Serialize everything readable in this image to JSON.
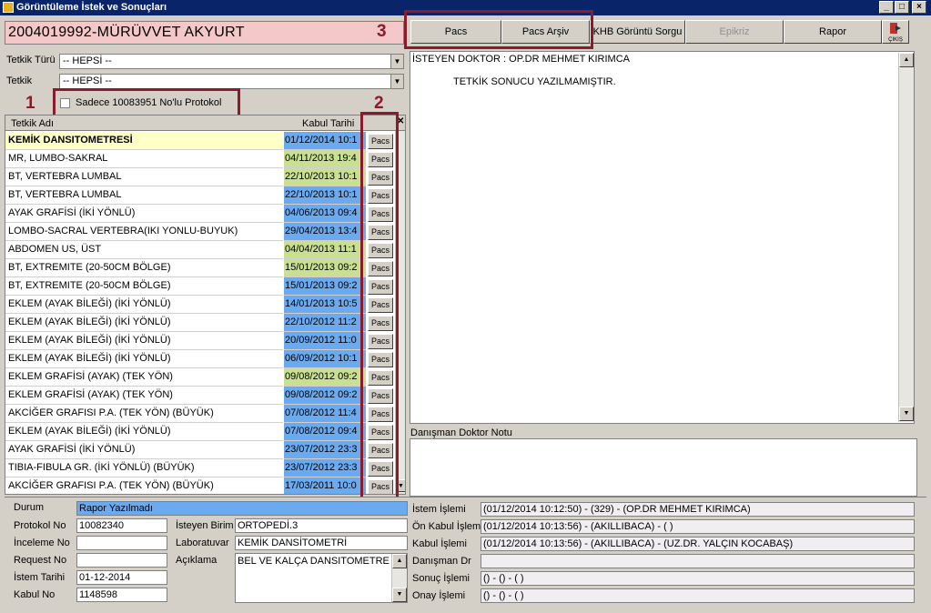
{
  "window": {
    "title": "Görüntüleme İstek ve Sonuçları"
  },
  "patient": {
    "header": "2004019992-MÜRÜVVET AKYURT"
  },
  "annotations": {
    "n1": "1",
    "n2": "2",
    "n3": "3"
  },
  "toolbar": {
    "pacs": "Pacs",
    "pacs_arsiv": "Pacs Arşiv",
    "khb": "KHB Görüntü Sorgu",
    "epikriz": "Epikriz",
    "rapor": "Rapor",
    "cikis": "ÇIKIŞ"
  },
  "filters": {
    "tetkik_turu_label": "Tetkik Türü",
    "tetkik_turu_value": "-- HEPSİ --",
    "tetkik_label": "Tetkik",
    "tetkik_value": "-- HEPSİ --",
    "protocol_checkbox_label": "Sadece 10083951 No'lu Protokol"
  },
  "grid": {
    "col_name": "Tetkik Adı",
    "col_date": "Kabul Tarihi",
    "pacs_label": "Pacs",
    "rows": [
      {
        "name": "KEMİK DANSITOMETRESİ",
        "date": "01/12/2014 10:1",
        "bold": true,
        "namecolor": "#ffffc8",
        "datecolor": "#6aaaf0"
      },
      {
        "name": "MR, LUMBO-SAKRAL",
        "date": "04/11/2013 19:4",
        "namecolor": "#ffffff",
        "datecolor": "#c8e090"
      },
      {
        "name": "BT, VERTEBRA LUMBAL",
        "date": "22/10/2013 10:1",
        "namecolor": "#ffffff",
        "datecolor": "#c8e090"
      },
      {
        "name": "BT, VERTEBRA LUMBAL",
        "date": "22/10/2013 10:1",
        "namecolor": "#ffffff",
        "datecolor": "#6aaaf0"
      },
      {
        "name": "AYAK GRAFİSİ (İKİ YÖNLÜ)",
        "date": "04/06/2013 09:4",
        "namecolor": "#ffffff",
        "datecolor": "#6aaaf0"
      },
      {
        "name": "LOMBO-SACRAL VERTEBRA(IKI YONLU-BUYUK)",
        "date": "29/04/2013 13:4",
        "namecolor": "#ffffff",
        "datecolor": "#6aaaf0"
      },
      {
        "name": "ABDOMEN US, ÜST",
        "date": "04/04/2013 11:1",
        "namecolor": "#ffffff",
        "datecolor": "#c8e090"
      },
      {
        "name": "BT, EXTREMITE (20-50CM BÖLGE)",
        "date": "15/01/2013 09:2",
        "namecolor": "#ffffff",
        "datecolor": "#c8e090"
      },
      {
        "name": "BT, EXTREMITE (20-50CM BÖLGE)",
        "date": "15/01/2013 09:2",
        "namecolor": "#ffffff",
        "datecolor": "#6aaaf0"
      },
      {
        "name": "EKLEM (AYAK BİLEĞİ) (İKİ YÖNLÜ)",
        "date": "14/01/2013 10:5",
        "namecolor": "#ffffff",
        "datecolor": "#6aaaf0"
      },
      {
        "name": "EKLEM (AYAK BİLEĞİ) (İKİ YÖNLÜ)",
        "date": "22/10/2012 11:2",
        "namecolor": "#ffffff",
        "datecolor": "#6aaaf0"
      },
      {
        "name": "EKLEM (AYAK BİLEĞİ) (İKİ YÖNLÜ)",
        "date": "20/09/2012 11:0",
        "namecolor": "#ffffff",
        "datecolor": "#6aaaf0"
      },
      {
        "name": "EKLEM (AYAK BİLEĞİ) (İKİ YÖNLÜ)",
        "date": "06/09/2012 10:1",
        "namecolor": "#ffffff",
        "datecolor": "#6aaaf0"
      },
      {
        "name": "EKLEM GRAFİSİ (AYAK) (TEK YÖN)",
        "date": "09/08/2012 09:2",
        "namecolor": "#ffffff",
        "datecolor": "#c8e090"
      },
      {
        "name": "EKLEM GRAFİSİ (AYAK) (TEK YÖN)",
        "date": "09/08/2012 09:2",
        "namecolor": "#ffffff",
        "datecolor": "#6aaaf0"
      },
      {
        "name": "AKCİĞER GRAFISI P.A. (TEK YÖN) (BÜYÜK)",
        "date": "07/08/2012 11:4",
        "namecolor": "#ffffff",
        "datecolor": "#6aaaf0"
      },
      {
        "name": "EKLEM (AYAK BİLEĞİ) (İKİ YÖNLÜ)",
        "date": "07/08/2012 09:4",
        "namecolor": "#ffffff",
        "datecolor": "#6aaaf0"
      },
      {
        "name": "AYAK GRAFİSİ (İKİ YÖNLÜ)",
        "date": "23/07/2012 23:3",
        "namecolor": "#ffffff",
        "datecolor": "#6aaaf0"
      },
      {
        "name": "TIBIA-FIBULA GR. (İKİ YÖNLÜ) (BÜYÜK)",
        "date": "23/07/2012 23:3",
        "namecolor": "#ffffff",
        "datecolor": "#6aaaf0"
      },
      {
        "name": "AKCİĞER GRAFISI P.A. (TEK YÖN) (BÜYÜK)",
        "date": "17/03/2011 10:0",
        "namecolor": "#ffffff",
        "datecolor": "#6aaaf0"
      }
    ]
  },
  "report": {
    "line1": "İSTEYEN DOKTOR : OP.DR MEHMET KIRIMCA",
    "line2": "TETKİK SONUCU YAZILMAMIŞTIR."
  },
  "consultant": {
    "label": "Danışman Doktor Notu",
    "value": ""
  },
  "details": {
    "durum_label": "Durum",
    "durum_value": "Rapor Yazılmadı",
    "protokol_label": "Protokol No",
    "protokol_value": "10082340",
    "inceleme_label": "İnceleme No",
    "inceleme_value": "",
    "request_label": "Request No",
    "request_value": "",
    "istem_tarihi_label": "İstem Tarihi",
    "istem_tarihi_value": "01-12-2014",
    "kabul_label": "Kabul No",
    "kabul_value": "1148598",
    "isteyen_birim_label": "İsteyen Birim",
    "isteyen_birim_value": "ORTOPEDİ.3",
    "laboratuvar_label": "Laboratuvar",
    "laboratuvar_value": "KEMİK DANSİTOMETRİ",
    "aciklama_label": "Açıklama",
    "aciklama_value": "BEL VE KALÇA DANSITOMETRE"
  },
  "process": {
    "istem_label": "İstem İşlemi",
    "istem_value": "(01/12/2014 10:12:50) - (329) - (OP.DR MEHMET KIRIMCA)",
    "on_kabul_label": "Ön Kabul İşlemi",
    "on_kabul_value": "(01/12/2014 10:13:56) - (AKILLIBACA) - (   )",
    "kabul_label": "Kabul İşlemi",
    "kabul_value": "(01/12/2014 10:13:56) - (AKILLIBACA) - (UZ.DR. YALÇIN KOCABAŞ)",
    "danisman_label": "Danışman Dr",
    "danisman_value": "",
    "sonuc_label": "Sonuç İşlemi",
    "sonuc_value": "() - () - (  )",
    "onay_label": "Onay İşlemi",
    "onay_value": "() - () - (  )"
  },
  "colors": {
    "selected_status": "#6aaaf0",
    "header_pink": "#f4c8c8",
    "annotation_red": "#8b1a2b"
  }
}
